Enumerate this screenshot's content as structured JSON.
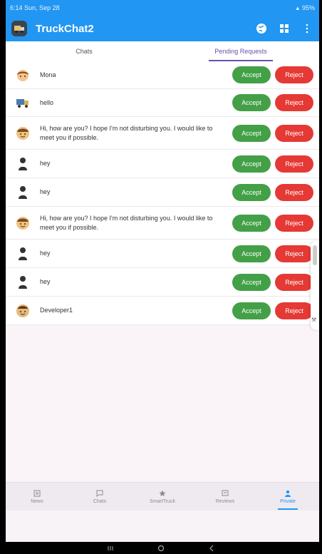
{
  "status_bar": {
    "time": "6:14",
    "date": "Sun, Sep 28",
    "battery": "95%"
  },
  "app_bar": {
    "title": "TruckChat2",
    "icons": [
      "truck-logo-icon",
      "globe-icon",
      "grid-icon",
      "more-vert-icon"
    ],
    "color": "#2196f3"
  },
  "tabs": [
    {
      "label": "Chats",
      "active": false
    },
    {
      "label": "Pending Requests",
      "active": true
    }
  ],
  "requests": [
    {
      "text": "Mona",
      "avatar": "girl-avatar-icon"
    },
    {
      "text": "hello",
      "avatar": "truck-avatar-icon"
    },
    {
      "text": "Hi, how are you? I hope I'm not disturbing you. I would like to meet you if possible.",
      "avatar": "face-avatar-icon"
    },
    {
      "text": "hey",
      "avatar": "person-avatar-icon"
    },
    {
      "text": "hey",
      "avatar": "person-avatar-icon"
    },
    {
      "text": "Hi, how are you? I hope I'm not disturbing you. I would like to meet you if possible.",
      "avatar": "face-avatar-icon"
    },
    {
      "text": "hey",
      "avatar": "person-avatar-icon"
    },
    {
      "text": "hey",
      "avatar": "person-avatar-icon"
    },
    {
      "text": "Developer1",
      "avatar": "face-avatar-icon"
    }
  ],
  "buttons": {
    "accept": "Accept",
    "reject": "Reject",
    "accept_color": "#43a047",
    "reject_color": "#e53935"
  },
  "bottom_nav": [
    {
      "label": "News",
      "icon": "news-icon",
      "active": false
    },
    {
      "label": "Chats",
      "icon": "chat-icon",
      "active": false
    },
    {
      "label": "SmartTruck",
      "icon": "star-icon",
      "active": false
    },
    {
      "label": "Reviews",
      "icon": "reviews-icon",
      "active": false
    },
    {
      "label": "Private",
      "icon": "person-icon",
      "active": true
    }
  ]
}
